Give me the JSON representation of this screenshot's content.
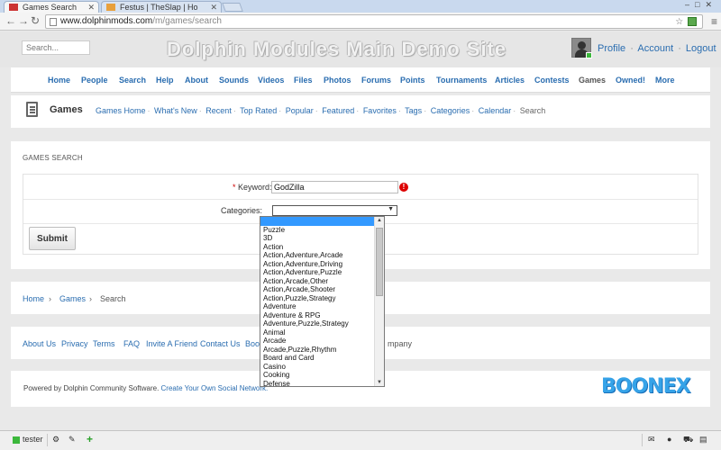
{
  "browser": {
    "tabs": [
      {
        "title": "Games Search"
      },
      {
        "title": "Festus | TheSlap | Ho"
      }
    ],
    "url_host": "www.dolphinmods.com",
    "url_path": "/m/games/search"
  },
  "site": {
    "search_placeholder": "Search...",
    "title": "Dolphin Modules Main Demo Site",
    "user_links": [
      "Profile",
      "Account",
      "Logout"
    ],
    "user_sep": "·"
  },
  "main_nav": [
    "Home",
    "People",
    "Search",
    "Help",
    "About",
    "Sounds",
    "Videos",
    "Files",
    "Photos",
    "Forums",
    "Points",
    "Tournaments",
    "Articles",
    "Contests",
    "Games",
    "Owned!",
    "More"
  ],
  "submenu": {
    "title": "Games",
    "links": [
      "Games Home",
      "What's New",
      "Recent",
      "Top Rated",
      "Popular",
      "Featured",
      "Favorites",
      "Tags",
      "Categories",
      "Calendar"
    ],
    "current": "Search"
  },
  "search_form": {
    "panel_title": "GAMES SEARCH",
    "keyword_required": "*",
    "keyword_label": "Keyword:",
    "keyword_value": "GodZilla",
    "categories_label": "Categories:",
    "submit_label": "Submit"
  },
  "category_options": [
    "",
    "Puzzle",
    "3D",
    "Action",
    "Action,Adventure,Arcade",
    "Action,Adventure,Driving",
    "Action,Adventure,Puzzle",
    "Action,Arcade,Other",
    "Action,Arcade,Shooter",
    "Action,Puzzle,Strategy",
    "Adventure",
    "Adventure & RPG",
    "Adventure,Puzzle,Strategy",
    "Animal",
    "Arcade",
    "Arcade,Puzzle,Rhythm",
    "Board and Card",
    "Casino",
    "Cooking",
    "Defense"
  ],
  "breadcrumb": {
    "items": [
      "Home",
      "Games"
    ],
    "current": "Search",
    "sep": "›"
  },
  "footer": {
    "links": [
      "About Us",
      "Privacy",
      "Terms",
      "FAQ",
      "Invite A Friend",
      "Contact Us",
      "Book"
    ],
    "trailing": "mpany",
    "powered_text": "Powered by Dolphin Community Software.",
    "powered_link": "Create Your Own Social Network."
  },
  "bottombar": {
    "user": "tester"
  },
  "colors": {
    "link": "#2a6db0",
    "selection": "#3399ff",
    "brand": "#36a3e8"
  }
}
